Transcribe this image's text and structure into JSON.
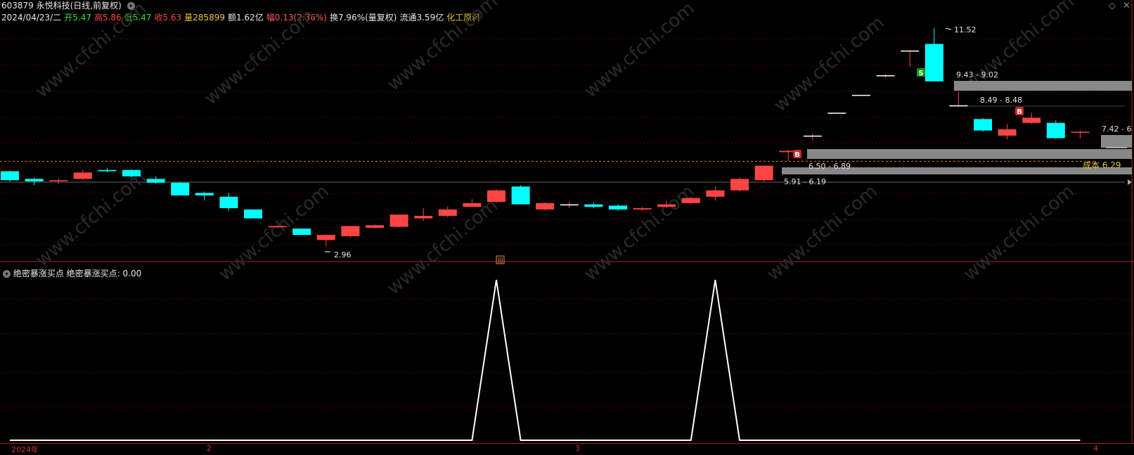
{
  "header": {
    "stock_title": "603879 永悦科技(日线,前复权)",
    "date": "2024/04/23/二",
    "open_label": "开",
    "open_value": "5.47",
    "high_label": "高",
    "high_value": "5.86",
    "low_label": "低",
    "low_value": "5.47",
    "close_label": "收",
    "close_value": "5.63",
    "volume_label": "量",
    "volume_value": "285899",
    "amount_label": "额",
    "amount_value": "1.62亿",
    "change_label": "幅",
    "change_value": "0.13(2.36%)",
    "turnover_label": "换",
    "turnover_value": "7.96%(量复权)",
    "float_label": "流通",
    "float_value": "3.59亿",
    "sector": "化工原料"
  },
  "annotations": {
    "high_price": "11.52",
    "low_price": "2.96",
    "zone1": "9.43 - 9.02",
    "zone2": "8.49 - 8.48",
    "zone3": "7.42 - 6",
    "zone4": "6.50 - 6.89",
    "zone5": "5.91 - 6.19",
    "cost": "成本 6.29",
    "signal_s": "S",
    "signal_b": "B",
    "marker": "回"
  },
  "indicator": {
    "title": "绝密暴涨买点  绝密暴涨买点: 0.00"
  },
  "xaxis": {
    "labels": [
      "2024年",
      "2",
      "3",
      "4"
    ]
  },
  "watermark": "www.cfchi.com",
  "colors": {
    "up": "#ff4444",
    "down": "#00ffff",
    "background": "#000000",
    "grid": "#5a0000",
    "cost_line": "#e08000",
    "zone_bar": "#888888",
    "indicator_line": "#ffffff"
  },
  "chart_data": {
    "type": "candlestick",
    "title": "603879 永悦科技(日线,前复权)",
    "price_range": [
      2.8,
      12.0
    ],
    "candles": [
      {
        "open": 5.9,
        "close": 5.55,
        "high": 5.92,
        "low": 5.5
      },
      {
        "open": 5.6,
        "close": 5.5,
        "high": 5.65,
        "low": 5.35
      },
      {
        "open": 5.52,
        "close": 5.55,
        "high": 5.62,
        "low": 5.4
      },
      {
        "open": 5.6,
        "close": 5.85,
        "high": 5.95,
        "low": 5.55
      },
      {
        "open": 5.95,
        "close": 5.9,
        "high": 6.02,
        "low": 5.85
      },
      {
        "open": 5.95,
        "close": 5.7,
        "high": 5.98,
        "low": 5.65
      },
      {
        "open": 5.6,
        "close": 5.45,
        "high": 5.7,
        "low": 5.42
      },
      {
        "open": 5.45,
        "close": 4.95,
        "high": 5.48,
        "low": 4.95
      },
      {
        "open": 5.05,
        "close": 4.95,
        "high": 5.1,
        "low": 4.75
      },
      {
        "open": 4.9,
        "close": 4.45,
        "high": 5.05,
        "low": 4.35
      },
      {
        "open": 4.4,
        "close": 4.05,
        "high": 4.4,
        "low": 4.05
      },
      {
        "open": 3.7,
        "close": 3.75,
        "high": 3.78,
        "low": 3.68
      },
      {
        "open": 3.65,
        "close": 3.4,
        "high": 3.65,
        "low": 3.4
      },
      {
        "open": 3.2,
        "close": 3.4,
        "high": 3.4,
        "low": 2.96
      },
      {
        "open": 3.35,
        "close": 3.75,
        "high": 3.75,
        "low": 3.3
      },
      {
        "open": 3.68,
        "close": 3.78,
        "high": 3.82,
        "low": 3.65
      },
      {
        "open": 3.72,
        "close": 4.2,
        "high": 4.2,
        "low": 3.7
      },
      {
        "open": 4.05,
        "close": 4.15,
        "high": 4.45,
        "low": 3.95
      },
      {
        "open": 4.15,
        "close": 4.4,
        "high": 4.52,
        "low": 4.1
      },
      {
        "open": 4.5,
        "close": 4.65,
        "high": 4.8,
        "low": 4.5
      },
      {
        "open": 4.7,
        "close": 5.15,
        "high": 5.2,
        "low": 4.65
      },
      {
        "open": 5.3,
        "close": 4.6,
        "high": 5.35,
        "low": 4.6
      },
      {
        "open": 4.4,
        "close": 4.65,
        "high": 4.68,
        "low": 4.35
      },
      {
        "open": 4.6,
        "close": 4.6,
        "high": 4.7,
        "low": 4.45
      },
      {
        "open": 4.6,
        "close": 4.5,
        "high": 4.68,
        "low": 4.45
      },
      {
        "open": 4.55,
        "close": 4.4,
        "high": 4.6,
        "low": 4.35
      },
      {
        "open": 4.4,
        "close": 4.45,
        "high": 4.5,
        "low": 4.35
      },
      {
        "open": 4.5,
        "close": 4.6,
        "high": 4.72,
        "low": 4.45
      },
      {
        "open": 4.65,
        "close": 4.85,
        "high": 4.9,
        "low": 4.6
      },
      {
        "open": 4.9,
        "close": 5.15,
        "high": 5.3,
        "low": 4.75
      },
      {
        "open": 5.15,
        "close": 5.6,
        "high": 5.65,
        "low": 5.1
      },
      {
        "open": 5.55,
        "close": 6.12,
        "high": 6.12,
        "low": 5.5
      },
      {
        "open": 6.65,
        "close": 6.7,
        "high": 6.75,
        "low": 6.3
      },
      {
        "open": 7.3,
        "close": 7.3,
        "high": 7.38,
        "low": 7.1
      },
      {
        "open": 8.2,
        "close": 8.2,
        "high": 8.2,
        "low": 8.2
      },
      {
        "open": 8.9,
        "close": 8.9,
        "high": 8.9,
        "low": 8.9
      },
      {
        "open": 9.67,
        "close": 9.67,
        "high": 9.72,
        "low": 9.58
      },
      {
        "open": 10.64,
        "close": 10.64,
        "high": 10.64,
        "low": 10.0
      },
      {
        "open": 10.9,
        "close": 9.43,
        "high": 11.52,
        "low": 9.43
      },
      {
        "open": 8.49,
        "close": 8.49,
        "high": 9.02,
        "low": 8.48
      },
      {
        "open": 7.95,
        "close": 7.5,
        "high": 8.0,
        "low": 7.45
      },
      {
        "open": 7.3,
        "close": 7.55,
        "high": 7.75,
        "low": 7.15
      },
      {
        "open": 7.8,
        "close": 8.0,
        "high": 8.2,
        "low": 7.75
      },
      {
        "open": 7.8,
        "close": 7.2,
        "high": 7.9,
        "low": 7.18
      },
      {
        "open": 7.42,
        "close": 7.45,
        "high": 7.5,
        "low": 7.2
      }
    ],
    "indicator_series": {
      "name": "绝密暴涨买点",
      "values": [
        0,
        0,
        0,
        0,
        0,
        0,
        0,
        0,
        0,
        0,
        0,
        0,
        0,
        0,
        0,
        0,
        0,
        0,
        0,
        0,
        1,
        0,
        0,
        0,
        0,
        0,
        0,
        0,
        0,
        1,
        0,
        0,
        0,
        0,
        0,
        0,
        0,
        0,
        0,
        0,
        0,
        0,
        0,
        0,
        0
      ]
    }
  }
}
